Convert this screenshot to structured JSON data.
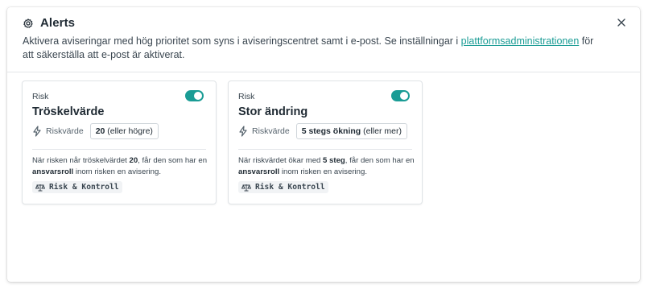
{
  "dialog": {
    "title": "Alerts",
    "desc_before": "Aktivera aviseringar med hög prioritet som syns i aviseringscentret samt i e-post. Se inställningar i ",
    "desc_link": "plattformsadministrationen",
    "desc_after": " för att säkerställa att e-post är aktiverat.",
    "icons": {
      "title": "gear-icon",
      "close": "close-icon"
    }
  },
  "colors": {
    "accent": "#1a9c95"
  },
  "cards": [
    {
      "category": "Risk",
      "enabled": true,
      "title": "Tröskelvärde",
      "metric_label": "Riskvärde",
      "metric_value_bold": "20",
      "metric_value_rest": " (eller högre)",
      "note_a": "När risken når tröskelvärdet ",
      "note_b": "20",
      "note_c": ", får den som har en ",
      "note_d": "ansvarsroll",
      "note_e": " inom risken en avisering.",
      "tag": "Risk & Kontroll"
    },
    {
      "category": "Risk",
      "enabled": true,
      "title": "Stor ändring",
      "metric_label": "Riskvärde",
      "metric_value_bold": "5 stegs ökning",
      "metric_value_rest": " (eller mer)",
      "note_a": "När riskvärdet ökar med ",
      "note_b": "5 steg",
      "note_c": ", får den som har en ",
      "note_d": "ansvarsroll",
      "note_e": " inom risken en avisering.",
      "tag": "Risk & Kontroll"
    }
  ]
}
